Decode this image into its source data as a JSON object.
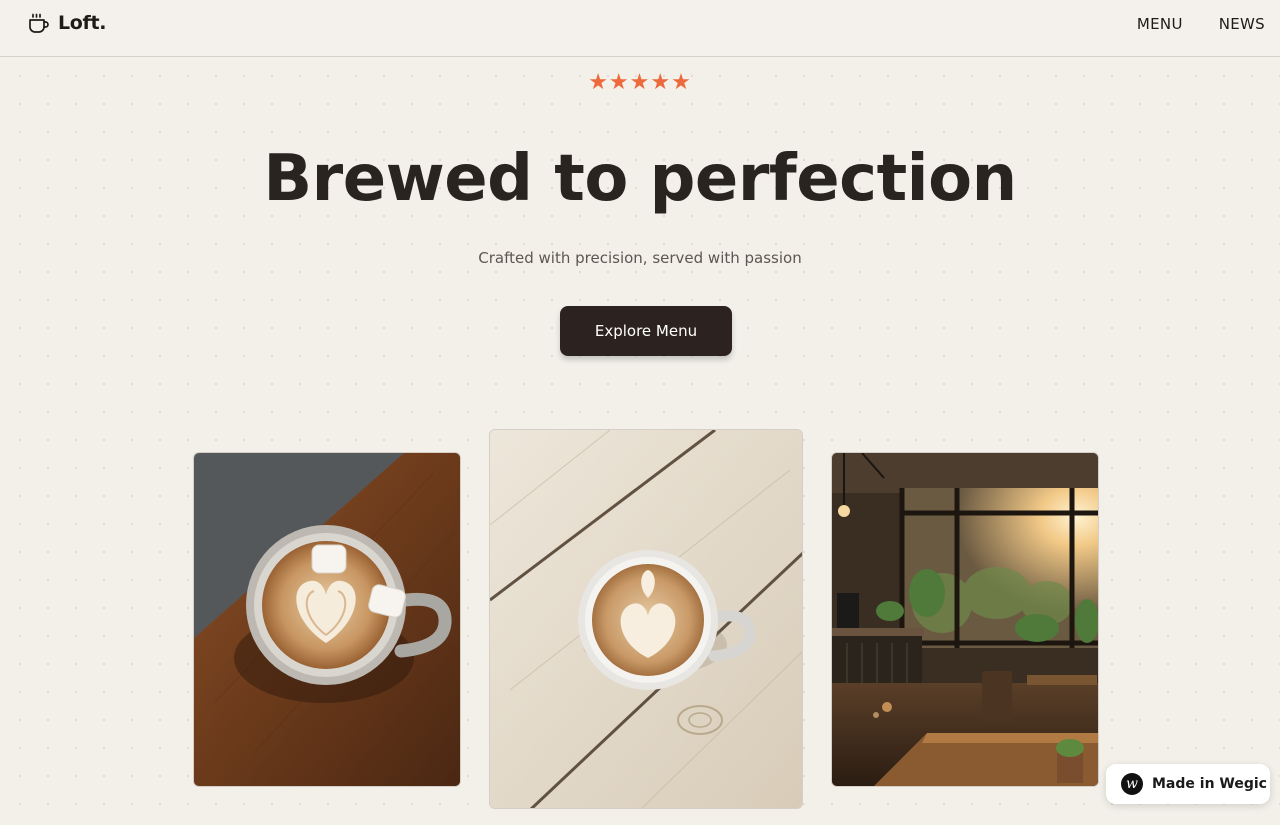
{
  "header": {
    "brand_name": "Loft.",
    "brand_icon": "coffee-cup-icon",
    "nav": [
      {
        "label": "MENU"
      },
      {
        "label": "NEWS"
      }
    ]
  },
  "hero": {
    "rating_stars": "★★★★★",
    "rating_value": 5,
    "rating_max": 5,
    "headline": "Brewed to perfection",
    "subheadline": "Crafted with precision, served with passion",
    "cta_label": "Explore Menu"
  },
  "gallery": [
    {
      "name": "latte-art-marshmallows-photo"
    },
    {
      "name": "latte-art-heart-photo"
    },
    {
      "name": "cafe-interior-photo"
    }
  ],
  "badge": {
    "logo_letter": "w",
    "label": "Made in Wegic"
  },
  "colors": {
    "background": "#f3f0ea",
    "accent_star": "#ec6a3c",
    "button": "#2c2320",
    "text_dark": "#2a2421",
    "text_muted": "#5e5651"
  }
}
